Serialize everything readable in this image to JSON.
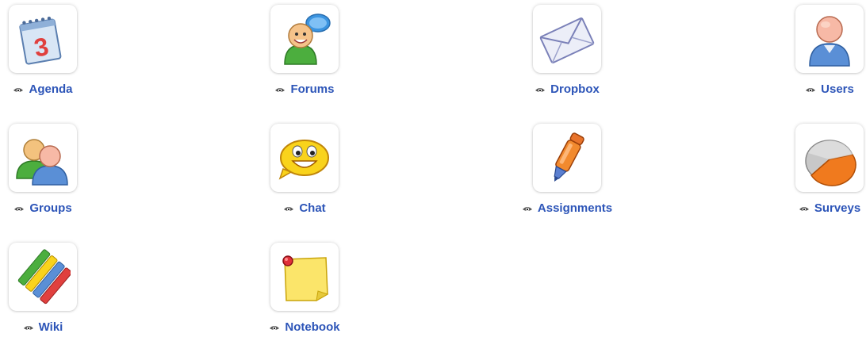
{
  "tools": [
    {
      "label": "Agenda",
      "icon": "calendar-icon"
    },
    {
      "label": "Forums",
      "icon": "forum-speech-icon"
    },
    {
      "label": "Dropbox",
      "icon": "envelope-icon"
    },
    {
      "label": "Users",
      "icon": "user-icon"
    },
    {
      "label": "Groups",
      "icon": "group-icon"
    },
    {
      "label": "Chat",
      "icon": "smiley-chat-icon"
    },
    {
      "label": "Assignments",
      "icon": "marker-pen-icon"
    },
    {
      "label": "Surveys",
      "icon": "pie-chart-icon"
    },
    {
      "label": "Wiki",
      "icon": "colored-pencils-icon"
    },
    {
      "label": "Notebook",
      "icon": "sticky-note-icon"
    }
  ],
  "visibility_icon": "eye-visible-icon",
  "colors": {
    "link": "#2d55b8",
    "accent_orange": "#f07a1e",
    "background": "#ffffff"
  }
}
